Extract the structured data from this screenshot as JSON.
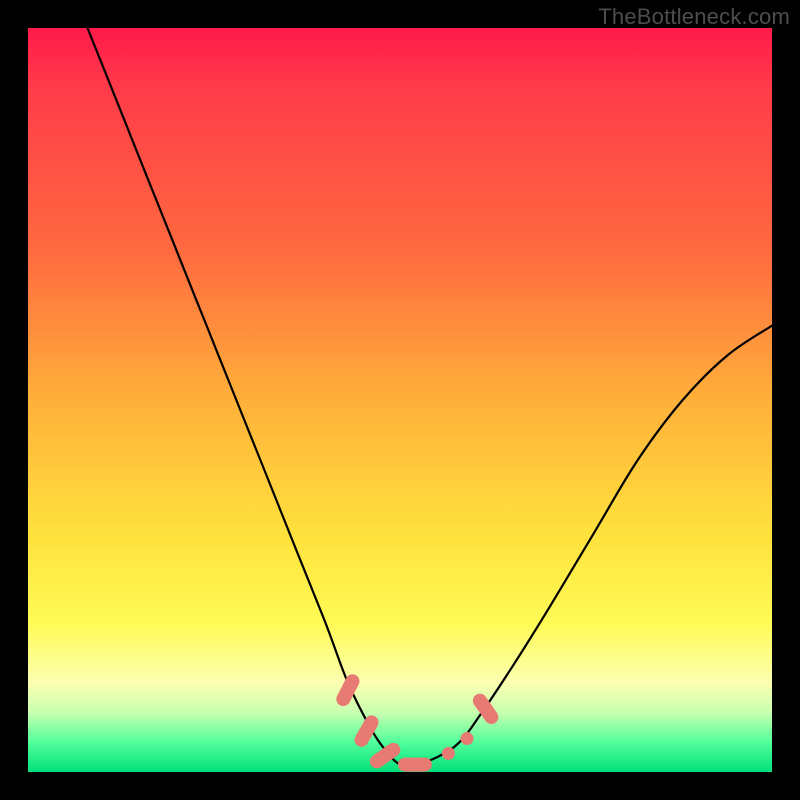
{
  "watermark": "TheBottleneck.com",
  "colors": {
    "frame": "#000000",
    "gradient_top": "#ff1a4a",
    "gradient_mid1": "#ff6a3f",
    "gradient_mid2": "#ffe13d",
    "gradient_bottom": "#00e07a",
    "curve": "#000000",
    "marker": "#e77a73"
  },
  "chart_data": {
    "type": "line",
    "title": "",
    "xlabel": "",
    "ylabel": "",
    "xlim": [
      0,
      100
    ],
    "ylim": [
      0,
      100
    ],
    "grid": false,
    "legend": false,
    "series": [
      {
        "name": "curve",
        "x": [
          8,
          12,
          16,
          20,
          24,
          28,
          32,
          36,
          40,
          43,
          46,
          48,
          50,
          52,
          55,
          58,
          61,
          65,
          70,
          76,
          82,
          88,
          94,
          100
        ],
        "values": [
          100,
          90,
          80,
          70,
          60,
          50,
          40,
          30,
          20,
          12,
          6,
          3,
          1,
          1,
          2,
          4,
          8,
          14,
          22,
          32,
          42,
          50,
          56,
          60
        ]
      }
    ],
    "markers": [
      {
        "x": 43.0,
        "y": 11.0,
        "shape": "pill",
        "rotation": -63
      },
      {
        "x": 45.5,
        "y": 5.5,
        "shape": "pill",
        "rotation": -60
      },
      {
        "x": 48.0,
        "y": 2.2,
        "shape": "pill",
        "rotation": -35
      },
      {
        "x": 52.0,
        "y": 1.0,
        "shape": "pill",
        "rotation": 0
      },
      {
        "x": 56.5,
        "y": 2.5,
        "shape": "dot",
        "rotation": 0
      },
      {
        "x": 59.0,
        "y": 4.5,
        "shape": "dot",
        "rotation": 0
      },
      {
        "x": 61.5,
        "y": 8.5,
        "shape": "pill",
        "rotation": 55
      }
    ]
  }
}
